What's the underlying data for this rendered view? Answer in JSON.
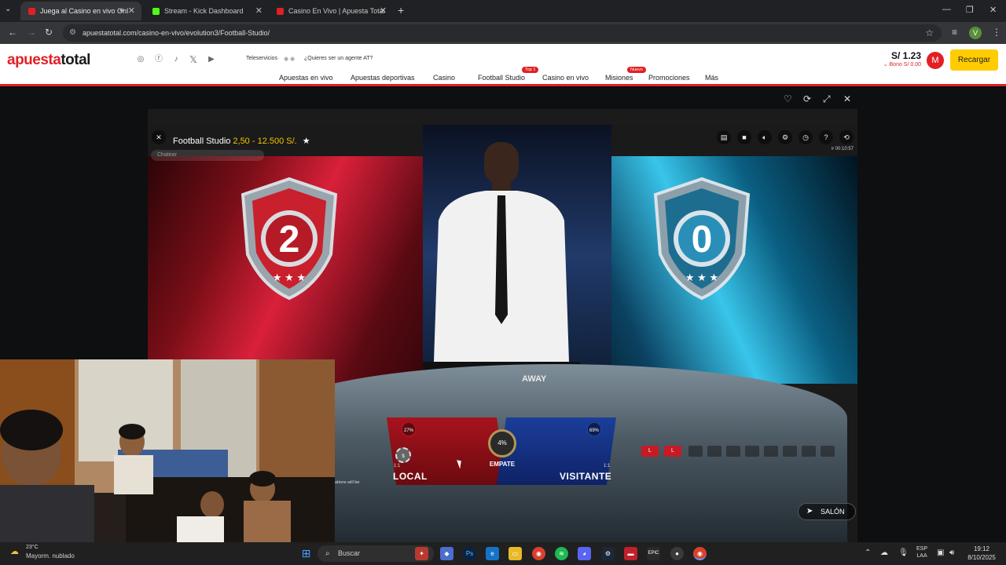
{
  "browser": {
    "tabs": [
      {
        "title": "Juega al Casino en vivo Onl",
        "active": true,
        "favicon_color": "#e21f26"
      },
      {
        "title": "Stream - Kick Dashboard",
        "active": false,
        "favicon_color": "#53fc18"
      },
      {
        "title": "Casino En Vivo | Apuesta Total",
        "active": false,
        "favicon_color": "#e21f26"
      }
    ],
    "new_tab": "+",
    "url": "apuestatotal.com/casino-en-vivo/evolution3/Football-Studio/",
    "profile_initial": "V"
  },
  "site": {
    "logo_red": "apuesta",
    "logo_black": "total",
    "teleservicios": "Teleservicios",
    "agent_prompt": "¿Quieres ser un agente AT?",
    "nav": [
      {
        "label": "Apuestas en vivo"
      },
      {
        "label": "Apuestas deportivas"
      },
      {
        "label": "Casino"
      },
      {
        "label": "Football Studio",
        "badge": "Top 1"
      },
      {
        "label": "Casino en vivo"
      },
      {
        "label": "Misiones",
        "badge": "Nuevo"
      },
      {
        "label": "Promociones"
      },
      {
        "label": "Más"
      }
    ],
    "balance": "S/ 1.23",
    "bonus": "Bono S/ 0.00",
    "avatar_initial": "M",
    "recharge_label": "Recargar"
  },
  "game": {
    "title": "Football Studio",
    "limits": "2,50 - 12.500 S/.",
    "chat_placeholder": "Chatear",
    "game_id": "# 00:10:57",
    "local_label": "LOCAL",
    "visitor_label": "VISITANTE",
    "tie_label": "EMPATE",
    "tie_pct": "4%",
    "local_pct": "27%",
    "visitor_pct": "69%",
    "local_odds": "1:1",
    "visitor_odds": "1:1",
    "home_score": "2",
    "away_score": "0",
    "table_away": "AWAY",
    "history": [
      "L",
      "L"
    ],
    "notice": "ations will be",
    "salon_label": "SALÓN"
  },
  "taskbar": {
    "weather_temp": "23°C",
    "weather_text": "Mayorm. nublado",
    "search_placeholder": "Buscar",
    "lang1": "ESP",
    "lang2": "LAA",
    "time": "19:12",
    "date": "8/10/2025"
  }
}
